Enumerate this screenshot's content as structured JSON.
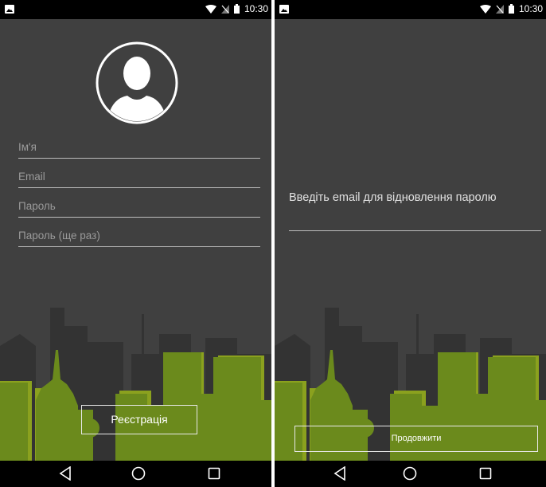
{
  "status_bar": {
    "time": "10:30",
    "icons": [
      "image-icon",
      "wifi-icon",
      "signal-icon",
      "battery-icon"
    ]
  },
  "register_screen": {
    "avatar_icon": "user-avatar-icon",
    "fields": [
      {
        "placeholder": "Ім'я",
        "value": ""
      },
      {
        "placeholder": "Email",
        "value": ""
      },
      {
        "placeholder": "Пароль",
        "value": ""
      },
      {
        "placeholder": "Пароль (ще раз)",
        "value": ""
      }
    ],
    "register_button": "Реєстрація"
  },
  "recovery_screen": {
    "prompt": "Введіть email для відновлення паролю",
    "email_value": "",
    "continue_button": "Продовжити"
  },
  "nav_bar": {
    "icons": [
      "back-icon",
      "home-icon",
      "recents-icon"
    ]
  },
  "colors": {
    "background": "#404040",
    "skyline_dark": "#333333",
    "skyline_green": "#6b8a1c",
    "skyline_green_shadow": "#8ba11e",
    "status_bar": "#000000"
  }
}
